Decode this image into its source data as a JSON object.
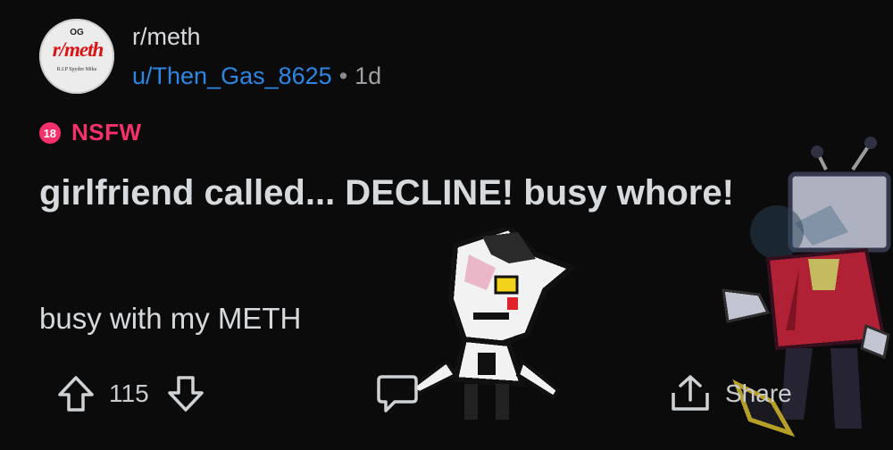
{
  "header": {
    "avatar_top": "OG",
    "avatar_name": "r/meth",
    "avatar_caption": "R.I.P Spyder Mike",
    "subreddit": "r/meth",
    "username": "u/Then_Gas_8625",
    "separator": "•",
    "age": "1d"
  },
  "nsfw": {
    "badge": "18",
    "label": "NSFW",
    "color": "#f5306a"
  },
  "post": {
    "title": "girlfriend called... DECLINE! busy whore!",
    "body": "busy with my METH"
  },
  "actions": {
    "upvote_icon": "arrow-up-icon",
    "score": "115",
    "downvote_icon": "arrow-down-icon",
    "comment_icon": "comment-bubble-icon",
    "share_icon": "share-icon",
    "share_label": "Share"
  },
  "colors": {
    "background": "#0b0b0c",
    "link": "#2b87e3",
    "text": "#d7dadc"
  }
}
